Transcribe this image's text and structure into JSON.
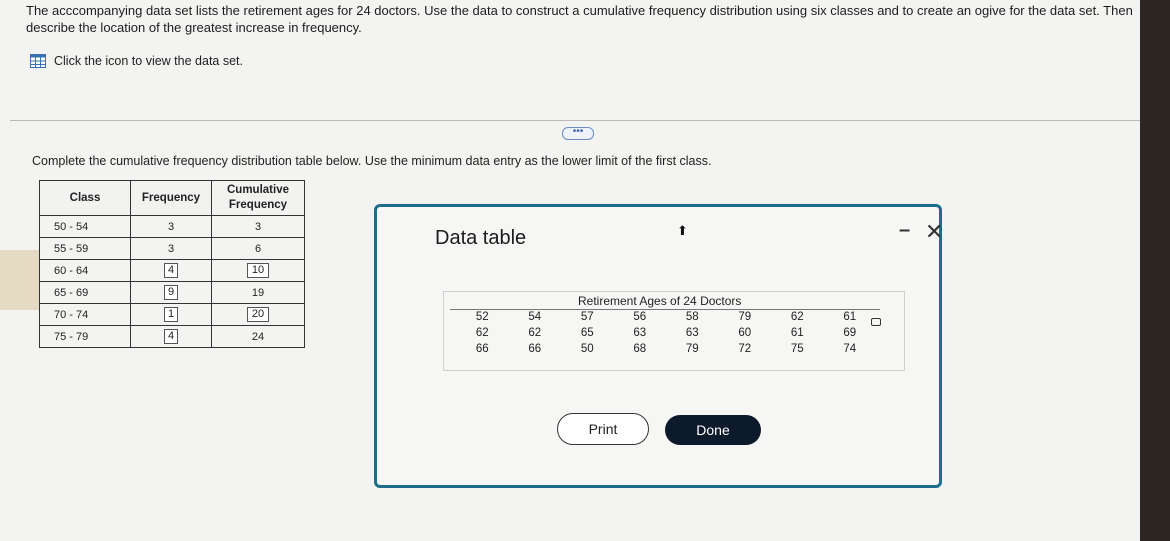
{
  "question": "The acccompanying data set lists the retirement ages for 24 doctors. Use the data to construct a cumulative frequency distribution using six classes and to create an ogive for the data set. Then describe the location of the greatest increase in frequency.",
  "click_text": "Click the icon to view the data set.",
  "expand_label": "•••",
  "instruction": "Complete the cumulative frequency distribution table below. Use the minimum data entry as the lower limit of the first class.",
  "table": {
    "headers": {
      "class": "Class",
      "frequency": "Frequency",
      "cumulative": "Cumulative Frequency"
    },
    "rows": [
      {
        "class": "50 - 54",
        "frequency": "3",
        "cumulative": "3"
      },
      {
        "class": "55 - 59",
        "frequency": "3",
        "cumulative": "6"
      },
      {
        "class": "60 - 64",
        "frequency": "4",
        "cumulative": "10"
      },
      {
        "class": "65 - 69",
        "frequency": "9",
        "cumulative": "19"
      },
      {
        "class": "70 - 74",
        "frequency": "1",
        "cumulative": "20"
      },
      {
        "class": "75 - 79",
        "frequency": "4",
        "cumulative": "24"
      }
    ]
  },
  "dialog": {
    "title": "Data table",
    "minimize": "–",
    "close": "✕",
    "caption": "Retirement Ages of 24 Doctors",
    "data": [
      [
        "52",
        "54",
        "57",
        "56",
        "58",
        "79",
        "62",
        "61"
      ],
      [
        "62",
        "62",
        "65",
        "63",
        "63",
        "60",
        "61",
        "69"
      ],
      [
        "66",
        "66",
        "50",
        "68",
        "79",
        "72",
        "75",
        "74"
      ]
    ],
    "print_label": "Print",
    "done_label": "Done"
  }
}
